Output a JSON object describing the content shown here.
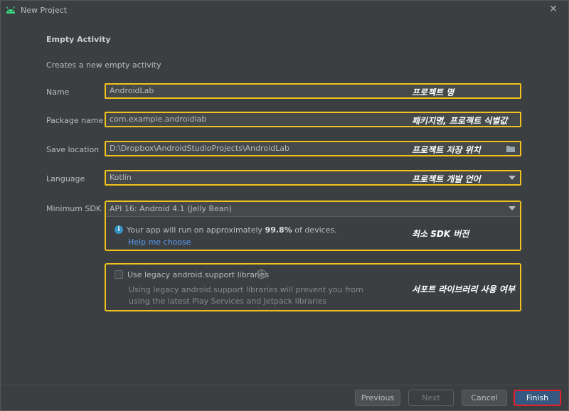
{
  "window": {
    "title": "New Project",
    "close_glyph": "✕"
  },
  "page": {
    "heading": "Empty Activity",
    "subheading": "Creates a new empty activity"
  },
  "form": {
    "name": {
      "label": "Name",
      "value": "AndroidLab",
      "annotation": "프로젝트 명"
    },
    "package": {
      "label": "Package name",
      "value": "com.example.androidlab",
      "annotation": "패키지명, 프로젝트 식별값"
    },
    "save_location": {
      "label": "Save location",
      "value": "D:\\Dropbox\\AndroidStudioProjects\\AndroidLab",
      "annotation": "프로젝트 저장 위치"
    },
    "language": {
      "label": "Language",
      "value": "Kotlin",
      "annotation": "프로젝트 개발 언어"
    },
    "min_sdk": {
      "label": "Minimum SDK",
      "value": "API 16: Android 4.1 (Jelly Bean)",
      "info_prefix": "Your app will run on approximately ",
      "info_percent": "99.8%",
      "info_suffix": " of devices.",
      "help_link": "Help me choose",
      "annotation": "최소 SDK 버전"
    },
    "legacy": {
      "label": "Use legacy android.support libraries",
      "description": "Using legacy android.support libraries will prevent you from using the latest Play Services and Jetpack libraries",
      "checked": false,
      "annotation": "서포트 라이브러리 사용 여부"
    }
  },
  "buttons": {
    "previous": "Previous",
    "next": "Next",
    "cancel": "Cancel",
    "finish": "Finish"
  },
  "colors": {
    "highlight": "#f1c21b",
    "primary_outline": "#e0202a"
  }
}
